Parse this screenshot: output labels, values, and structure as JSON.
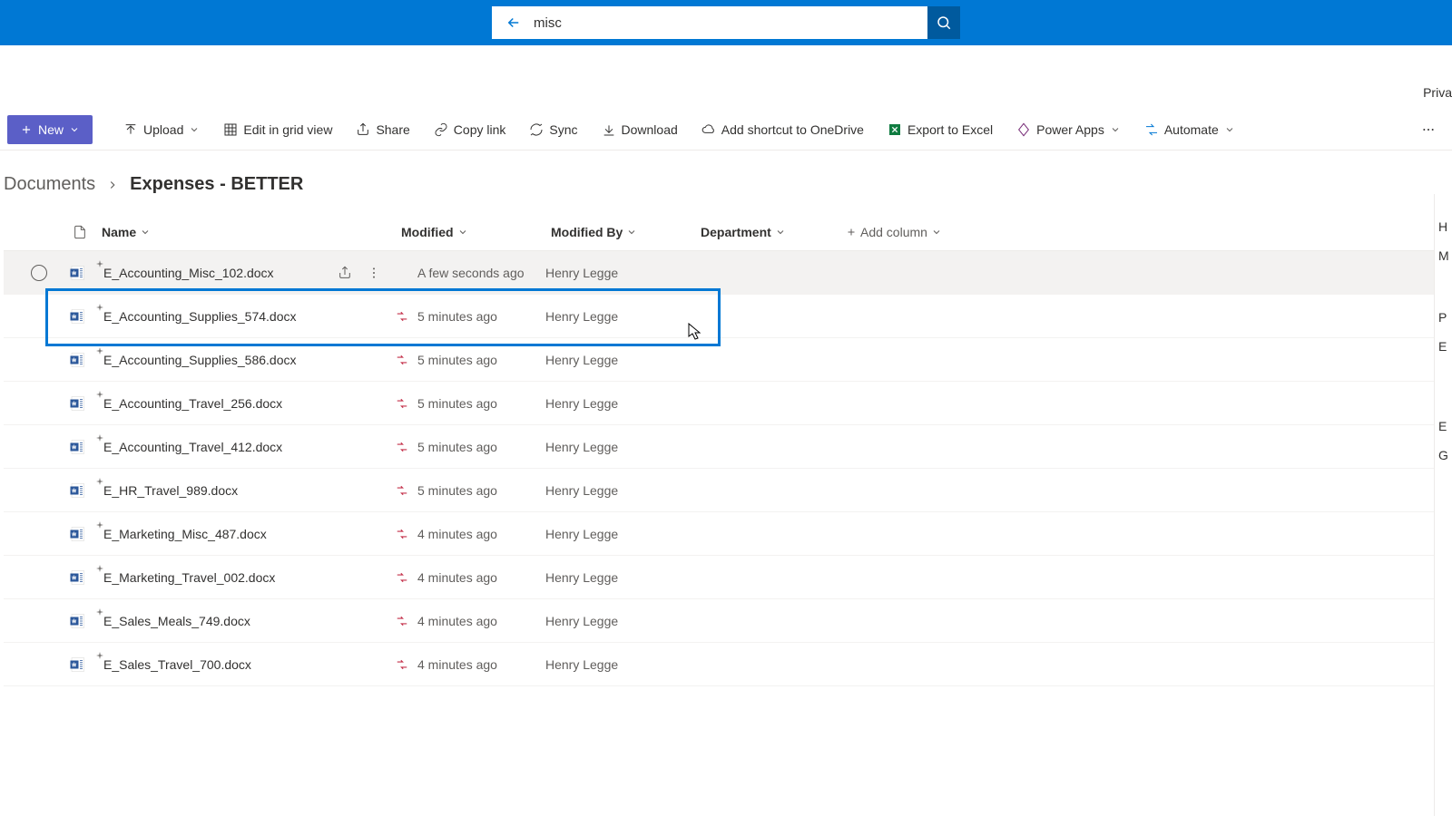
{
  "search": {
    "value": "misc"
  },
  "subheader": {
    "private_label": "Priva"
  },
  "commands": {
    "new": "New",
    "upload": "Upload",
    "edit_grid": "Edit in grid view",
    "share": "Share",
    "copy_link": "Copy link",
    "sync": "Sync",
    "download": "Download",
    "shortcut": "Add shortcut to OneDrive",
    "export": "Export to Excel",
    "power_apps": "Power Apps",
    "automate": "Automate"
  },
  "breadcrumb": {
    "parent": "Documents",
    "current": "Expenses - BETTER"
  },
  "columns": {
    "name": "Name",
    "modified": "Modified",
    "modified_by": "Modified By",
    "department": "Department",
    "add": "Add column"
  },
  "rows": [
    {
      "name": "E_Accounting_Misc_102.docx",
      "modified": "A few seconds ago",
      "modified_by": "Henry Legge",
      "selected": true,
      "flow": false
    },
    {
      "name": "E_Accounting_Supplies_574.docx",
      "modified": "5 minutes ago",
      "modified_by": "Henry Legge",
      "selected": false,
      "flow": true
    },
    {
      "name": "E_Accounting_Supplies_586.docx",
      "modified": "5 minutes ago",
      "modified_by": "Henry Legge",
      "selected": false,
      "flow": true
    },
    {
      "name": "E_Accounting_Travel_256.docx",
      "modified": "5 minutes ago",
      "modified_by": "Henry Legge",
      "selected": false,
      "flow": true
    },
    {
      "name": "E_Accounting_Travel_412.docx",
      "modified": "5 minutes ago",
      "modified_by": "Henry Legge",
      "selected": false,
      "flow": true
    },
    {
      "name": "E_HR_Travel_989.docx",
      "modified": "5 minutes ago",
      "modified_by": "Henry Legge",
      "selected": false,
      "flow": true
    },
    {
      "name": "E_Marketing_Misc_487.docx",
      "modified": "4 minutes ago",
      "modified_by": "Henry Legge",
      "selected": false,
      "flow": true
    },
    {
      "name": "E_Marketing_Travel_002.docx",
      "modified": "4 minutes ago",
      "modified_by": "Henry Legge",
      "selected": false,
      "flow": true
    },
    {
      "name": "E_Sales_Meals_749.docx",
      "modified": "4 minutes ago",
      "modified_by": "Henry Legge",
      "selected": false,
      "flow": true
    },
    {
      "name": "E_Sales_Travel_700.docx",
      "modified": "4 minutes ago",
      "modified_by": "Henry Legge",
      "selected": false,
      "flow": true
    }
  ],
  "right_panel": [
    "H",
    "M",
    "P",
    "E",
    "E",
    "G"
  ]
}
